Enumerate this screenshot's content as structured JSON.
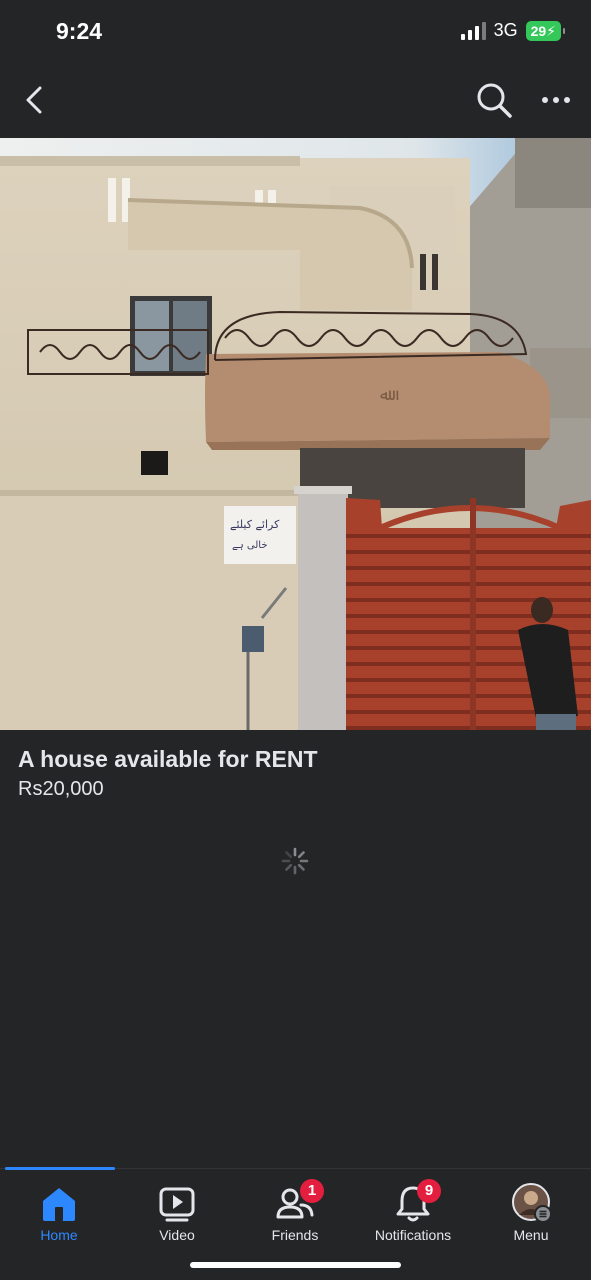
{
  "status_bar": {
    "time": "9:24",
    "network": "3G",
    "battery": "29"
  },
  "nav": {
    "back_icon": "chevron-left-icon",
    "search_icon": "search-icon",
    "more_icon": "more-horizontal-icon"
  },
  "listing": {
    "photo_description_icon": "house-photo",
    "title": "A house available for RENT",
    "price": "Rs20,000",
    "loading": true
  },
  "tab_bar": {
    "accent_color": "#2d88ff",
    "badge_color": "#e41e3f",
    "tabs": [
      {
        "label": "Home",
        "icon": "home-icon",
        "active": true
      },
      {
        "label": "Video",
        "icon": "video-icon",
        "active": false
      },
      {
        "label": "Friends",
        "icon": "friends-icon",
        "active": false,
        "badge": "1"
      },
      {
        "label": "Notifications",
        "icon": "bell-icon",
        "active": false,
        "badge": "9"
      },
      {
        "label": "Menu",
        "icon": "avatar-menu-icon",
        "active": false
      }
    ]
  }
}
